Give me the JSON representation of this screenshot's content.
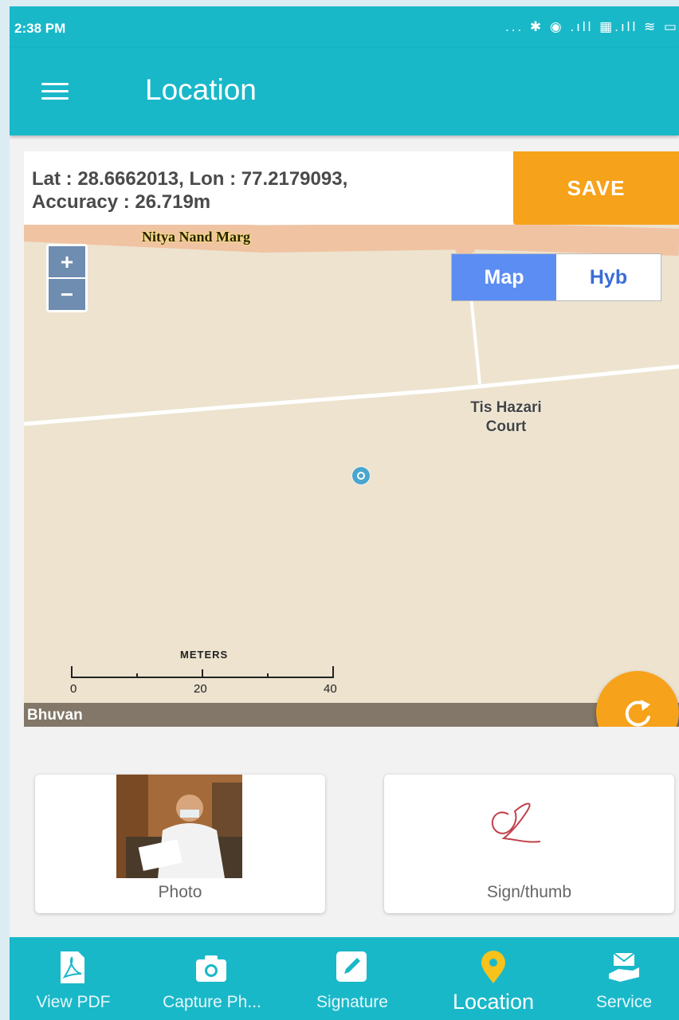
{
  "status_bar": {
    "time": "2:38 PM",
    "icons": "... ✱ ◉ .ıll ▦.ıll ≋ ▭"
  },
  "app_bar": {
    "title": "Location"
  },
  "location_panel": {
    "coords": "Lat : 28.6662013, Lon : 77.2179093,",
    "accuracy": "Accuracy : 26.719m",
    "save_label": "SAVE"
  },
  "map": {
    "road_label": "Nitya Nand Marg",
    "place_label": "Tis Hazari Court",
    "zoom_in": "+",
    "zoom_out": "−",
    "layer_map": "Map",
    "layer_hybrid": "Hyb",
    "scale_unit": "METERS",
    "scale_ticks": [
      "0",
      "20",
      "40"
    ],
    "attribution": "Bhuvan"
  },
  "attachments": {
    "photo_label": "Photo",
    "sign_label": "Sign/thumb"
  },
  "bottom_nav": {
    "items": [
      {
        "label": "View PDF",
        "icon": "pdf-icon"
      },
      {
        "label": "Capture Ph...",
        "icon": "camera-icon"
      },
      {
        "label": "Signature",
        "icon": "pencil-icon"
      },
      {
        "label": "Location",
        "icon": "location-pin-icon"
      },
      {
        "label": "Service",
        "icon": "service-hand-icon"
      }
    ],
    "active": "Location"
  },
  "colors": {
    "primary": "#19b8c9",
    "accent": "#f7a21b",
    "map_background": "#ede3cf",
    "active_nav_icon": "#f7c21b"
  }
}
